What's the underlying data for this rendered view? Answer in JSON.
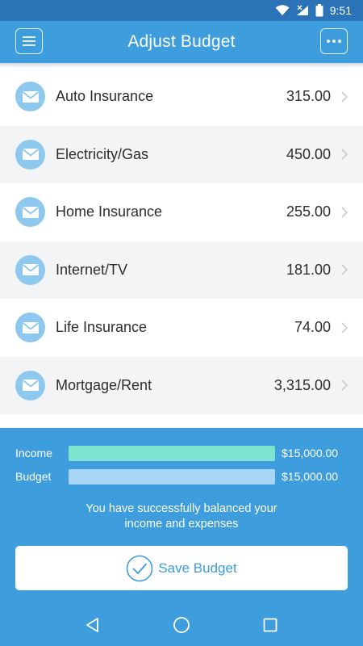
{
  "status_bar": {
    "time": "9:51"
  },
  "header": {
    "title": "Adjust Budget"
  },
  "items": [
    {
      "label": "Auto Insurance",
      "amount": "315.00"
    },
    {
      "label": "Electricity/Gas",
      "amount": "450.00"
    },
    {
      "label": "Home Insurance",
      "amount": "255.00"
    },
    {
      "label": "Internet/TV",
      "amount": "181.00"
    },
    {
      "label": "Life Insurance",
      "amount": "74.00"
    },
    {
      "label": "Mortgage/Rent",
      "amount": "3,315.00"
    },
    {
      "label": "",
      "amount": ""
    }
  ],
  "summary": {
    "income_label": "Income",
    "income_value": "$15,000.00",
    "income_fill": 1.0,
    "budget_label": "Budget",
    "budget_value": "$15,000.00",
    "budget_fill": 1.0,
    "message": "You have successfully balanced your income and expenses",
    "save_label": "Save Budget"
  },
  "colors": {
    "primary": "#3d9ddd",
    "status_bar": "#2a73b7",
    "income_bar": "#7ee3cf",
    "budget_bar": "#a8d5f5",
    "icon_bg": "#8fc8ee"
  }
}
